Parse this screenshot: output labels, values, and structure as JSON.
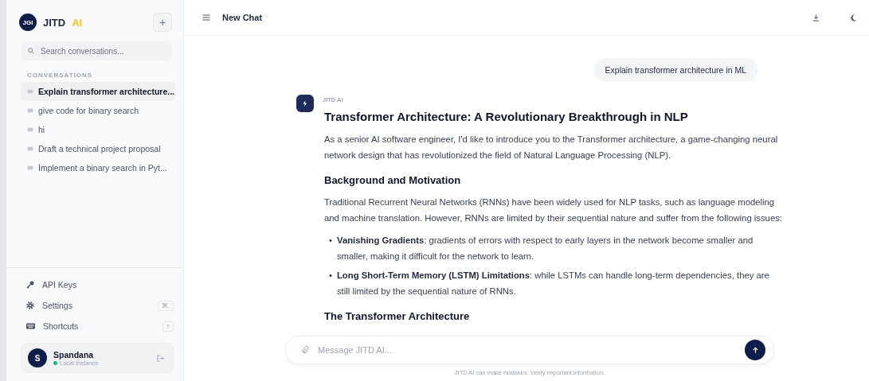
{
  "sidebar": {
    "logo_badge": "JGI",
    "brand": "JITD",
    "brand_accent": "AI",
    "new_button": "+",
    "search": {
      "placeholder": "Search conversations..."
    },
    "section_label": "CONVERSATIONS",
    "conversations": [
      {
        "title": "Explain transformer architecture...",
        "selected": true
      },
      {
        "title": "give code for binary search",
        "selected": false
      },
      {
        "title": "hi",
        "selected": false
      },
      {
        "title": "Draft a technical project proposal",
        "selected": false
      },
      {
        "title": "Implement a binary search in Pyt...",
        "selected": false
      }
    ],
    "footer_items": [
      {
        "kind": "key",
        "label": "API Keys"
      },
      {
        "kind": "gear",
        "label": "Settings",
        "shortcut": "⌘,"
      },
      {
        "kind": "keyboard",
        "label": "Shortcuts",
        "shortcut": "?"
      }
    ],
    "user": {
      "initial": "S",
      "name": "Spandana",
      "status": "Local Instance",
      "online": true
    }
  },
  "header": {
    "title": "New Chat"
  },
  "messages": [
    {
      "kind": "user",
      "text": "Explain transformer architecture in ML"
    },
    {
      "kind": "assistant",
      "sender": "JITD AI",
      "blocks": [
        {
          "kind": "h1",
          "text": "Transformer Architecture: A Revolutionary Breakthrough in NLP"
        },
        {
          "kind": "p",
          "text": "As a senior AI software engineer, I'd like to introduce you to the Transformer architecture, a game-changing neural network design that has revolutionized the field of Natural Language Processing (NLP)."
        },
        {
          "kind": "h2",
          "text": "Background and Motivation"
        },
        {
          "kind": "p",
          "text": "Traditional Recurrent Neural Networks (RNNs) have been widely used for NLP tasks, such as language modeling and machine translation. However, RNNs are limited by their sequential nature and suffer from the following issues:"
        },
        {
          "kind": "ul",
          "items": [
            {
              "marker": "•",
              "text": "**Vanishing Gradients**: gradients of errors with respect to early layers in the network become smaller and smaller, making it difficult for the network to learn."
            },
            {
              "marker": "•",
              "text": "**Long Short-Term Memory (LSTM) Limitations**: while LSTMs can handle long-term dependencies, they are still limited by the sequential nature of RNNs."
            }
          ]
        },
        {
          "kind": "h2",
          "text": "The Transformer Architecture"
        }
      ]
    }
  ],
  "composer": {
    "placeholder": "Message JITD AI...",
    "disclaimer": "JITD AI can make mistakes. Verify important information."
  }
}
